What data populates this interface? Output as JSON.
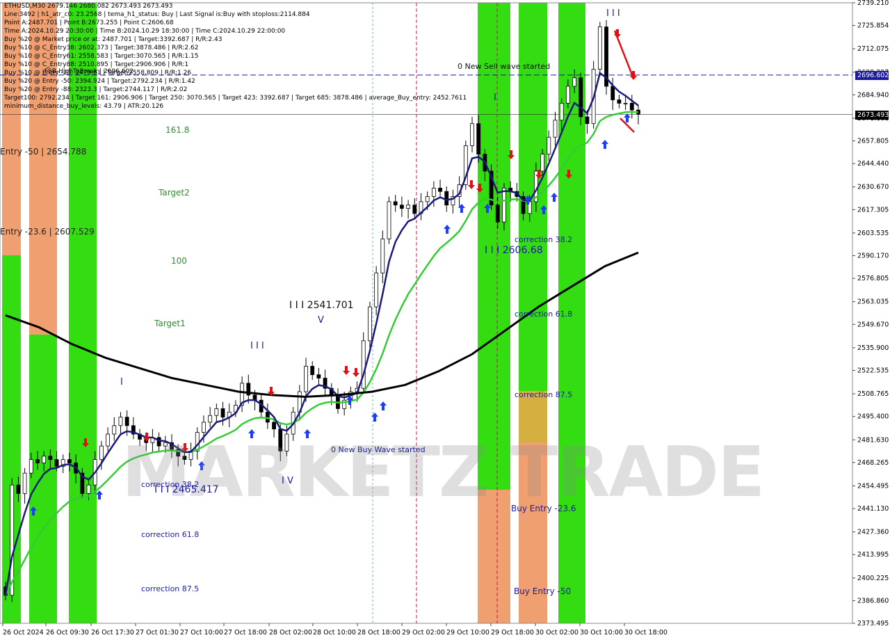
{
  "chart_data": {
    "type": "candlestick",
    "symbol": "ETHUSD,M30",
    "ohlc_header": "2679.146 2680.082 2673.493 2673.493",
    "ylim": [
      2373.495,
      2739.21
    ],
    "y_ticks": [
      2739.21,
      2725.854,
      2712.075,
      2698.297,
      2684.94,
      2671.161,
      2657.805,
      2644.44,
      2630.67,
      2617.305,
      2603.535,
      2590.17,
      2576.805,
      2563.035,
      2549.67,
      2535.9,
      2522.535,
      2508.765,
      2495.4,
      2481.63,
      2468.265,
      2454.495,
      2441.13,
      2427.36,
      2413.995,
      2400.225,
      2386.86,
      2373.495
    ],
    "y_tick_labels": [
      "2739.210",
      "2725.854",
      "2712.075",
      "2698.297",
      "2684.940",
      "2671.161",
      "2657.805",
      "2644.440",
      "2630.670",
      "2617.305",
      "2603.535",
      "2590.170",
      "2576.805",
      "2563.035",
      "2549.670",
      "2535.900",
      "2522.535",
      "2508.765",
      "2495.400",
      "2481.630",
      "2468.265",
      "2454.495",
      "2441.130",
      "2427.360",
      "2413.995",
      "2400.225",
      "2386.860",
      "2373.495"
    ],
    "x_tick_labels": [
      "26 Oct 2024",
      "26 Oct 09:30",
      "26 Oct 17:30",
      "27 Oct 01:30",
      "27 Oct 10:00",
      "27 Oct 18:00",
      "28 Oct 02:00",
      "28 Oct 10:00",
      "28 Oct 18:00",
      "29 Oct 02:00",
      "29 Oct 10:00",
      "29 Oct 18:00",
      "30 Oct 02:00",
      "30 Oct 10:00",
      "30 Oct 18:00"
    ],
    "close_series": [
      2390,
      2455,
      2450,
      2462,
      2470,
      2468,
      2472,
      2470,
      2466,
      2470,
      2468,
      2462,
      2450,
      2455,
      2470,
      2478,
      2485,
      2490,
      2495,
      2490,
      2485,
      2482,
      2480,
      2483,
      2478,
      2480,
      2476,
      2472,
      2470,
      2475,
      2486,
      2492,
      2496,
      2500,
      2495,
      2498,
      2502,
      2515,
      2508,
      2505,
      2498,
      2492,
      2488,
      2475,
      2485,
      2498,
      2510,
      2525,
      2520,
      2518,
      2512,
      2508,
      2500,
      2505,
      2510,
      2512,
      2540,
      2560,
      2580,
      2600,
      2622,
      2620,
      2618,
      2620,
      2615,
      2622,
      2625,
      2630,
      2628,
      2620,
      2625,
      2632,
      2655,
      2668,
      2650,
      2640,
      2620,
      2610,
      2630,
      2628,
      2625,
      2615,
      2622,
      2640,
      2650,
      2660,
      2670,
      2680,
      2690,
      2695,
      2672,
      2668,
      2700,
      2725,
      2690,
      2682,
      2680,
      2680,
      2676,
      2673.493
    ],
    "ma_lines": [
      {
        "name": "EMA fast",
        "color": "#1a1a7a"
      },
      {
        "name": "EMA mid",
        "color": "#33cc33"
      },
      {
        "name": "EMA slow",
        "color": "#000000"
      }
    ],
    "horizontal_lines": [
      2696.602,
      2673.493
    ]
  },
  "info": {
    "lines": [
      "ETHUSD,M30  2679.146 2680.082 2673.493 2673.493",
      "Line:3492 | h1_atr_c0: 23.2568 | tema_h1_status: Buy | Last Signal is:Buy with stoploss:2114.884",
      "Point A:2487.701 | Point B:2673.255 | Point C:2606.68",
      "Time A:2024.10.29 20:30:00 | Time B:2024.10.29 18:30:00 | Time C:2024.10.29 22:00:00",
      "Buy %20 @ Market price or at: 2487.701 | Target:3392.687 | R/R:2.43",
      "Buy %10 @ C_Entry38: 2602.373 | Target:3878.486 | R/R:2.62",
      "Buy %10 @ C_Entry61: 2558.583 | Target:3070.565 | R/R:1.15",
      "Buy %10 @ C_Entry88: 2510.895 | Target:2906.906 | R/R:1",
      "Buy %10 @ Entry -23: 2473.81 | Target:2558.809 | R/R:1.26",
      "Buy %20 @ Entry -50: 2394.924 | Target:2792.234 | R/R:1.42",
      "Buy %20 @ Entry -88: 2323.3 | Target:2744.117 | R/R:2.02",
      "Target100: 2792.234 | Target 161: 2906.906 | Target 250: 3070.565 | Target 423: 3392.687 | Target 685: 3878.486 | average_Buy_entry: 2452.7611",
      "minimum_distance_buy_levels: 43.79 | ATR:20.126"
    ],
    "overlap_labels": [
      "FSB-HighToBreak | 2696.602"
    ]
  },
  "annotations": {
    "entry50": "Entry -50 | 2654.788",
    "entry236": "Entry -23.6 | 2607.529",
    "lvl1618": "161.8",
    "target2": "Target2",
    "lvl100": "100",
    "target1": "Target1",
    "wave3_left": "I I I",
    "wave1_left": "I",
    "wave_price_2541": "I I I 2541.701",
    "wave5_v": "V",
    "wave4": "I V",
    "wave_price_2465": "I I I 2465.417",
    "corr382_left": "correction 38.2",
    "corr618_left": "correction 61.8",
    "corr875_left": "correction 87.5",
    "new_buy_wave": "0 New Buy Wave started",
    "new_sell_wave": "0 New Sell wave started",
    "wave_top": "I I I",
    "wave_i_mid": "I",
    "wave_price_2606": "I I I 2606.68",
    "corr382_right": "correction 38.2",
    "corr618_right": "correction 61.8",
    "corr875_right": "correction 87.5",
    "buy_entry_236": "Buy Entry -23.6",
    "buy_entry_50": "Buy Entry -50",
    "watermark": "MARKETZ TRADE"
  },
  "price_boxes": {
    "high_to_break": "2696.602",
    "current": "2673.493"
  },
  "colors": {
    "green_zone": "#33dd11",
    "orange_zone": "#f0a070",
    "gold_zone": "#d4b040",
    "bull": "#000000",
    "bear": "#000000",
    "blue_line": "#1a1a7a",
    "green_line": "#33cc33",
    "black_line": "#000000",
    "dashed_blue": "#1a1aa0",
    "arrow_blue": "#1e3cff",
    "arrow_red": "#e01010"
  }
}
